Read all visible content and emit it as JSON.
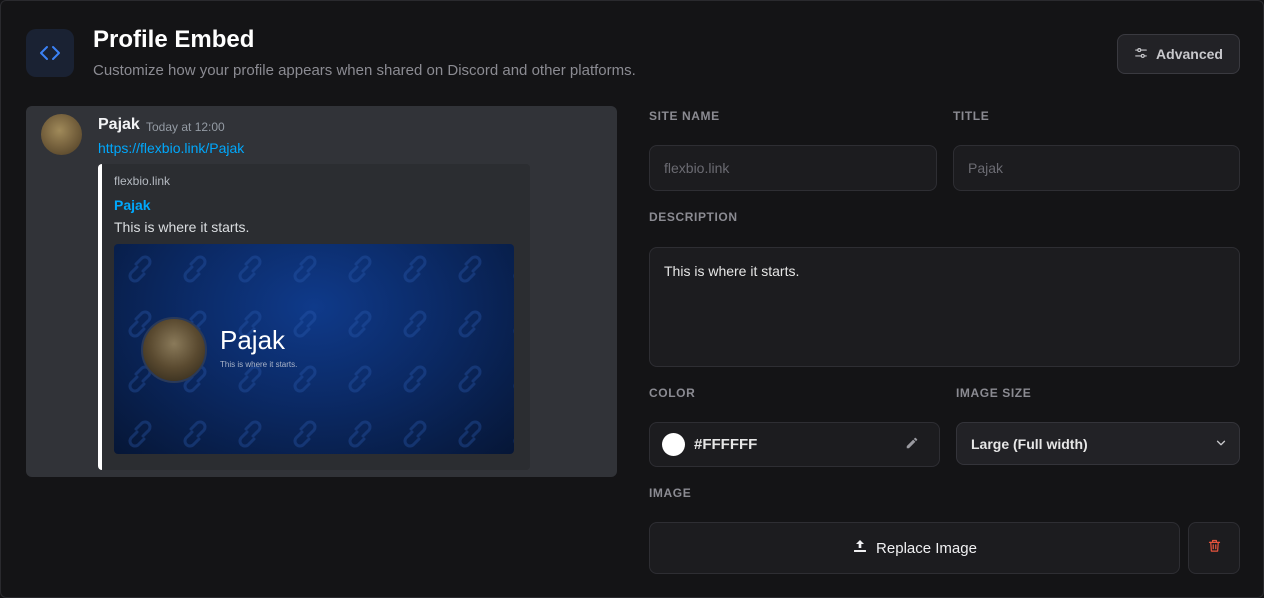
{
  "header": {
    "title": "Profile Embed",
    "subtitle": "Customize how your profile appears when shared on Discord and other platforms.",
    "icon": "code-icon",
    "advanced_label": "Advanced",
    "advanced_icon": "sliders-icon"
  },
  "preview": {
    "username": "Pajak",
    "timestamp": "Today at 12:00",
    "link": "https://flexbio.link/Pajak",
    "embed": {
      "site": "flexbio.link",
      "title": "Pajak",
      "description": "This is where it starts.",
      "image_name": "Pajak",
      "image_description": "This is where it starts."
    }
  },
  "form": {
    "site_name_label": "SITE NAME",
    "site_name_placeholder": "flexbio.link",
    "title_label": "TITLE",
    "title_placeholder": "Pajak",
    "description_label": "DESCRIPTION",
    "description_value": "This is where it starts.",
    "color_label": "COLOR",
    "color_value": "#FFFFFF",
    "image_size_label": "IMAGE SIZE",
    "image_size_value": "Large (Full width)",
    "image_label": "IMAGE",
    "replace_label": "Replace Image"
  },
  "colors": {
    "accent": "#00a8fc",
    "embed_border": "#FFFFFF",
    "delete": "#e5533d",
    "icon_blue": "#3b82f6"
  }
}
